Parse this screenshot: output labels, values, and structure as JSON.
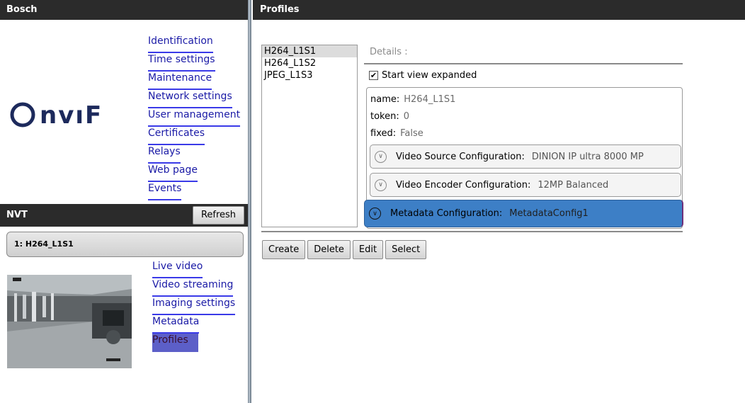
{
  "left_header": {
    "title": "Bosch"
  },
  "right_header": {
    "title": "Profiles"
  },
  "onvif_logo": {
    "text": "Onvif"
  },
  "device_nav": {
    "items": [
      {
        "label": "Identification"
      },
      {
        "label": "Time settings"
      },
      {
        "label": "Maintenance"
      },
      {
        "label": "Network settings"
      },
      {
        "label": "User management"
      },
      {
        "label": "Certificates"
      },
      {
        "label": "Relays"
      },
      {
        "label": "Web page"
      },
      {
        "label": "Events"
      }
    ]
  },
  "nvt": {
    "title": "NVT",
    "refresh_label": "Refresh",
    "selected_profile": "1: H264_L1S1"
  },
  "profile_nav": {
    "items": [
      {
        "label": "Live video"
      },
      {
        "label": "Video streaming"
      },
      {
        "label": "Imaging settings"
      },
      {
        "label": "Metadata"
      },
      {
        "label": "Profiles",
        "active": true
      }
    ]
  },
  "profiles_list": {
    "items": [
      "H264_L1S1",
      "H264_L1S2",
      "JPEG_L1S3"
    ],
    "selected": "H264_L1S1"
  },
  "details": {
    "label": "Details :",
    "start_view_expanded_label": "Start view expanded",
    "start_view_expanded_checked": true,
    "fields": [
      {
        "key": "name:",
        "value": "H264_L1S1"
      },
      {
        "key": "token:",
        "value": "0"
      },
      {
        "key": "fixed:",
        "value": "False"
      }
    ],
    "configurations": [
      {
        "key": "Video Source Configuration:",
        "value": "DINION IP ultra 8000 MP",
        "expanded": false
      },
      {
        "key": "Video Encoder Configuration:",
        "value": "12MP Balanced",
        "expanded": false
      },
      {
        "key": "Metadata Configuration:",
        "value": "MetadataConfig1",
        "selected": true
      }
    ]
  },
  "actions": {
    "create": "Create",
    "delete": "Delete",
    "edit": "Edit",
    "select": "Select"
  },
  "colors": {
    "header_bg": "#2b2b2b",
    "link": "#1a1aa6",
    "selected_config": "#3d7fc6",
    "active_nav": "#5c5fc8"
  }
}
